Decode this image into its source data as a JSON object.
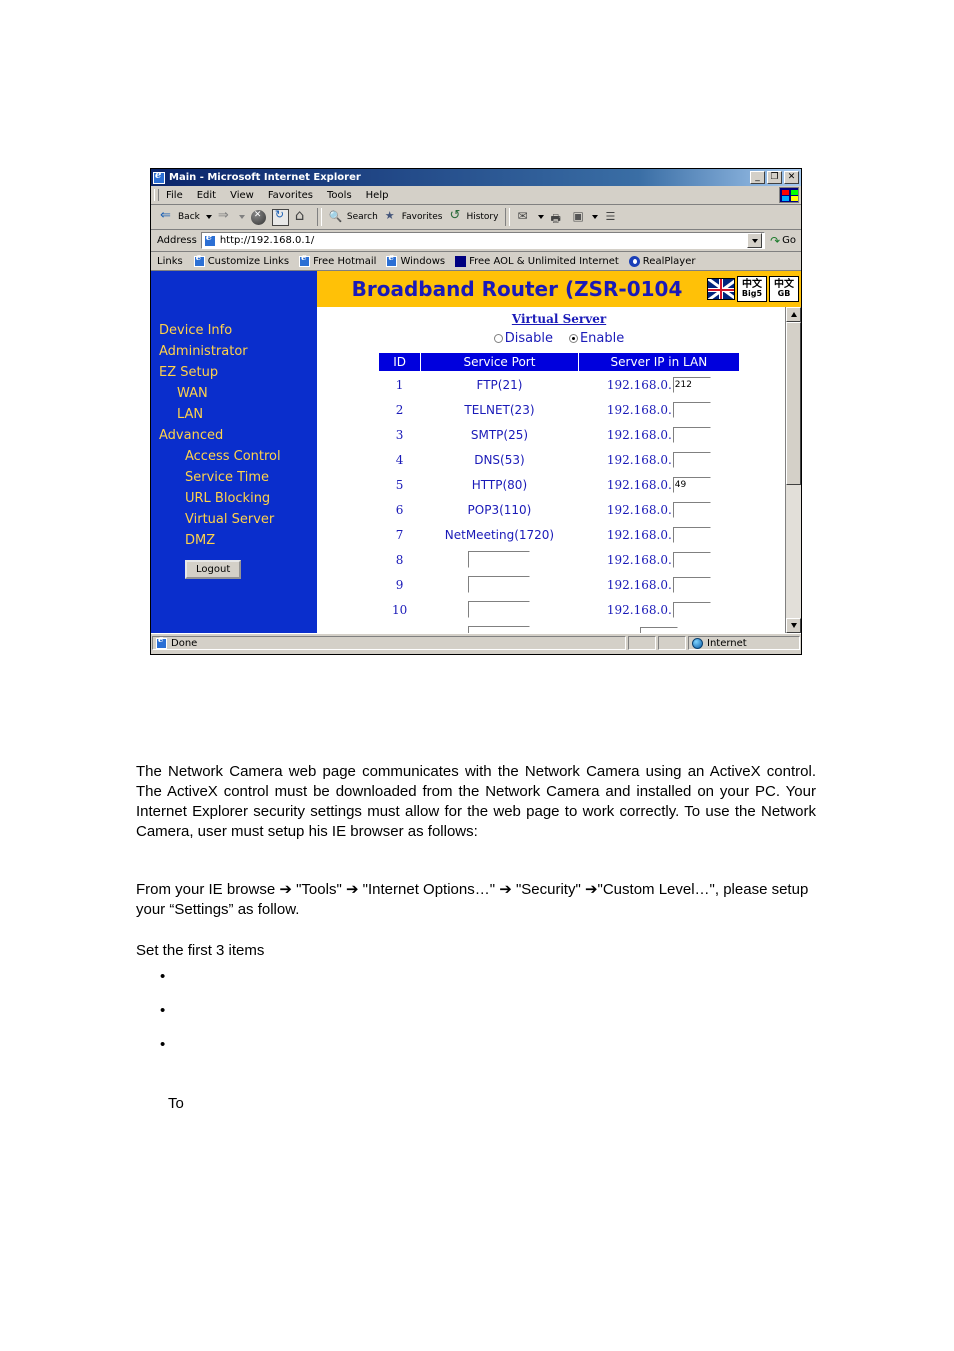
{
  "browser": {
    "title": "Main - Microsoft Internet Explorer",
    "window_buttons": {
      "minimize": "_",
      "restore": "❐",
      "close": "✕"
    },
    "menus": [
      "File",
      "Edit",
      "View",
      "Favorites",
      "Tools",
      "Help"
    ],
    "toolbar": [
      {
        "label": "Back",
        "icon": "back-arrow-icon"
      },
      {
        "label": "",
        "icon": "forward-arrow-icon"
      },
      {
        "label": "",
        "icon": "stop-icon"
      },
      {
        "label": "",
        "icon": "refresh-icon"
      },
      {
        "label": "",
        "icon": "home-icon"
      },
      {
        "label": "Search",
        "icon": "search-icon"
      },
      {
        "label": "Favorites",
        "icon": "favorites-star-icon"
      },
      {
        "label": "History",
        "icon": "history-icon"
      },
      {
        "label": "",
        "icon": "mail-icon"
      },
      {
        "label": "",
        "icon": "print-icon"
      },
      {
        "label": "",
        "icon": "edit-icon"
      },
      {
        "label": "",
        "icon": "discuss-icon"
      }
    ],
    "address": {
      "label": "Address",
      "url": "http://192.168.0.1/",
      "go_label": "Go"
    },
    "links": {
      "label": "Links",
      "items": [
        "Customize Links",
        "Free Hotmail",
        "Windows",
        "Free AOL & Unlimited Internet",
        "RealPlayer"
      ]
    },
    "status": {
      "text": "Done",
      "zone": "Internet"
    }
  },
  "router": {
    "header_title": "Broadband Router (ZSR-0104",
    "lang_buttons": [
      {
        "cn": "中文",
        "code": "Big5"
      },
      {
        "cn": "中文",
        "code": "GB"
      }
    ],
    "nav": [
      {
        "label": "Device Info",
        "level": 0
      },
      {
        "label": "Administrator",
        "level": 0
      },
      {
        "label": "EZ Setup",
        "level": 0
      },
      {
        "label": "WAN",
        "level": 1
      },
      {
        "label": "LAN",
        "level": 1
      },
      {
        "label": "Advanced",
        "level": 0
      },
      {
        "label": "Access Control",
        "level": 2
      },
      {
        "label": "Service Time",
        "level": 2
      },
      {
        "label": "URL Blocking",
        "level": 2
      },
      {
        "label": "Virtual Server",
        "level": 2
      },
      {
        "label": "DMZ",
        "level": 2
      }
    ],
    "logout_label": "Logout",
    "page_title": "Virtual Server",
    "radio_disable": "Disable",
    "radio_enable": "Enable",
    "selected_radio": "Enable",
    "table": {
      "headers": [
        "ID",
        "Service Port",
        "Server IP in LAN"
      ],
      "ip_prefix": "192.168.0.",
      "rows": [
        {
          "id": "1",
          "port": "FTP(21)",
          "port_editable": false,
          "ip": "212"
        },
        {
          "id": "2",
          "port": "TELNET(23)",
          "port_editable": false,
          "ip": ""
        },
        {
          "id": "3",
          "port": "SMTP(25)",
          "port_editable": false,
          "ip": ""
        },
        {
          "id": "4",
          "port": "DNS(53)",
          "port_editable": false,
          "ip": ""
        },
        {
          "id": "5",
          "port": "HTTP(80)",
          "port_editable": false,
          "ip": "49"
        },
        {
          "id": "6",
          "port": "POP3(110)",
          "port_editable": false,
          "ip": ""
        },
        {
          "id": "7",
          "port": "NetMeeting(1720)",
          "port_editable": false,
          "ip": ""
        },
        {
          "id": "8",
          "port": "",
          "port_editable": true,
          "ip": ""
        },
        {
          "id": "9",
          "port": "",
          "port_editable": true,
          "ip": ""
        },
        {
          "id": "10",
          "port": "",
          "port_editable": true,
          "ip": ""
        }
      ]
    }
  },
  "document": {
    "paragraph1": "The Network Camera web page communicates with the Network Camera using an ActiveX control. The ActiveX control must be downloaded from the Network Camera and installed on your PC. Your Internet Explorer security settings must allow for the web page to work correctly. To use the Network Camera, user must setup his IE browser as follows:",
    "paragraph2": "From your IE browse ➔ \"Tools\" ➔ \"Internet Options…\" ➔ \"Security\" ➔\"Custom Level…\", please setup your “Settings” as follow.",
    "paragraph3": "Set the first 3 items",
    "bullets": [
      "",
      "",
      ""
    ],
    "paragraph4": "To"
  },
  "colors": {
    "header_gold": "#ffc107",
    "sidebar_blue": "#0a2ecc",
    "table_header_blue": "#0000dd",
    "link_blue": "#1a1ab8",
    "nav_yellow": "#ffd24a"
  }
}
